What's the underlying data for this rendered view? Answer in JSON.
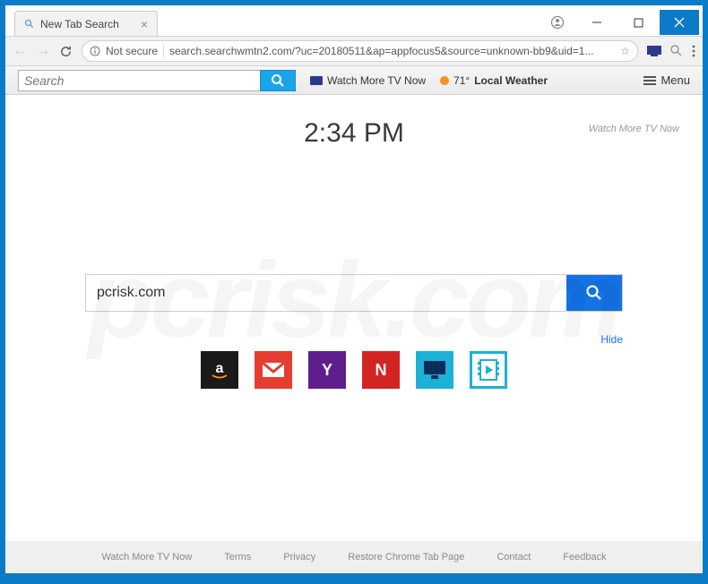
{
  "window": {
    "tab_title": "New Tab Search",
    "account_aria": "Account"
  },
  "addressbar": {
    "security_label": "Not secure",
    "url": "search.searchwmtn2.com/?uc=20180511&ap=appfocus5&source=unknown-bb9&uid=1..."
  },
  "toolbar": {
    "search_placeholder": "Search",
    "tv_label": "Watch More TV Now",
    "weather_temp": "71°",
    "weather_label": "Local Weather",
    "menu_label": "Menu"
  },
  "content": {
    "clock": "2:34 PM",
    "brand_link": "Watch More TV Now",
    "search_value": "pcrisk.com",
    "hide_label": "Hide"
  },
  "tiles": {
    "amazon": "amazon",
    "gmail": "gmail",
    "yahoo": "yahoo",
    "netflix": "netflix",
    "monitor": "monitor",
    "film": "film"
  },
  "footer": {
    "l1": "Watch More TV Now",
    "l2": "Terms",
    "l3": "Privacy",
    "l4": "Restore Chrome Tab Page",
    "l5": "Contact",
    "l6": "Feedback"
  },
  "watermark": "pcrisk.com"
}
